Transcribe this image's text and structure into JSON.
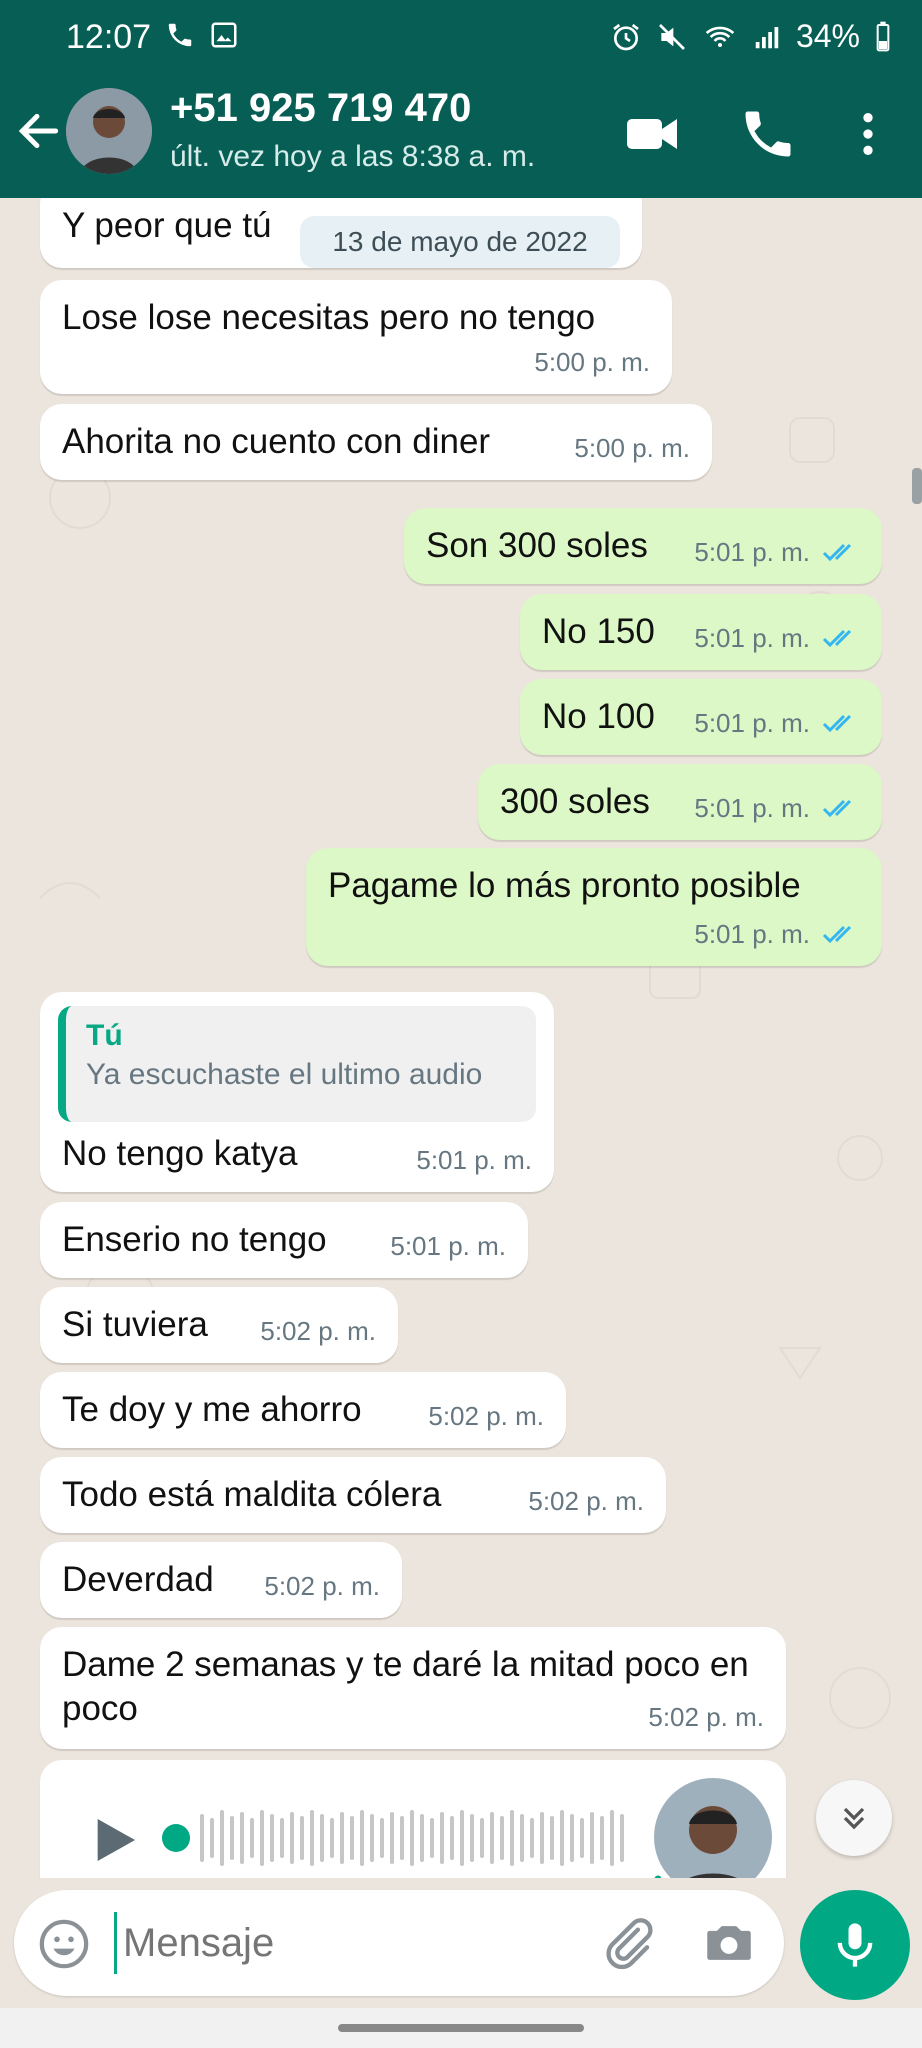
{
  "status_bar": {
    "time": "12:07",
    "battery": "34%"
  },
  "header": {
    "contact_name": "+51 925 719 470",
    "last_seen": "últ. vez hoy a las 8:38 a. m."
  },
  "date_separator": "13 de mayo de 2022",
  "messages": [
    {
      "text": "Y peor que tú",
      "time": "",
      "dir": "in"
    },
    {
      "text": "Lose lose necesitas pero no tengo",
      "time": "5:00 p. m.",
      "dir": "in"
    },
    {
      "text": "Ahorita no cuento con diner",
      "time": "5:00 p. m.",
      "dir": "in"
    },
    {
      "text": "Son 300 soles",
      "time": "5:01 p. m.",
      "dir": "out"
    },
    {
      "text": "No 150",
      "time": "5:01 p. m.",
      "dir": "out"
    },
    {
      "text": "No 100",
      "time": "5:01 p. m.",
      "dir": "out"
    },
    {
      "text": "300 soles",
      "time": "5:01 p. m.",
      "dir": "out"
    },
    {
      "text": "Pagame lo más pronto posible",
      "time": "5:01 p. m.",
      "dir": "out"
    },
    {
      "text": "No tengo katya",
      "time": "5:01 p. m.",
      "dir": "in",
      "quote": {
        "author": "Tú",
        "text": "Ya escuchaste el ultimo audio"
      }
    },
    {
      "text": "Enserio no tengo",
      "time": "5:01 p. m.",
      "dir": "in"
    },
    {
      "text": "Si tuviera",
      "time": "5:02 p. m.",
      "dir": "in"
    },
    {
      "text": "Te doy y me ahorro",
      "time": "5:02 p. m.",
      "dir": "in"
    },
    {
      "text": "Todo está maldita cólera",
      "time": "5:02 p. m.",
      "dir": "in"
    },
    {
      "text": "Deverdad",
      "time": "5:02 p. m.",
      "dir": "in"
    },
    {
      "text": "Dame 2 semanas y te daré la mitad poco en poco",
      "time": "5:02 p. m.",
      "dir": "in"
    }
  ],
  "input": {
    "placeholder": "Mensaje"
  },
  "colors": {
    "header": "#075e54",
    "accent": "#00a884",
    "outgoing": "#dcf8c6",
    "incoming": "#ffffff",
    "read_ticks": "#34b7f1"
  }
}
